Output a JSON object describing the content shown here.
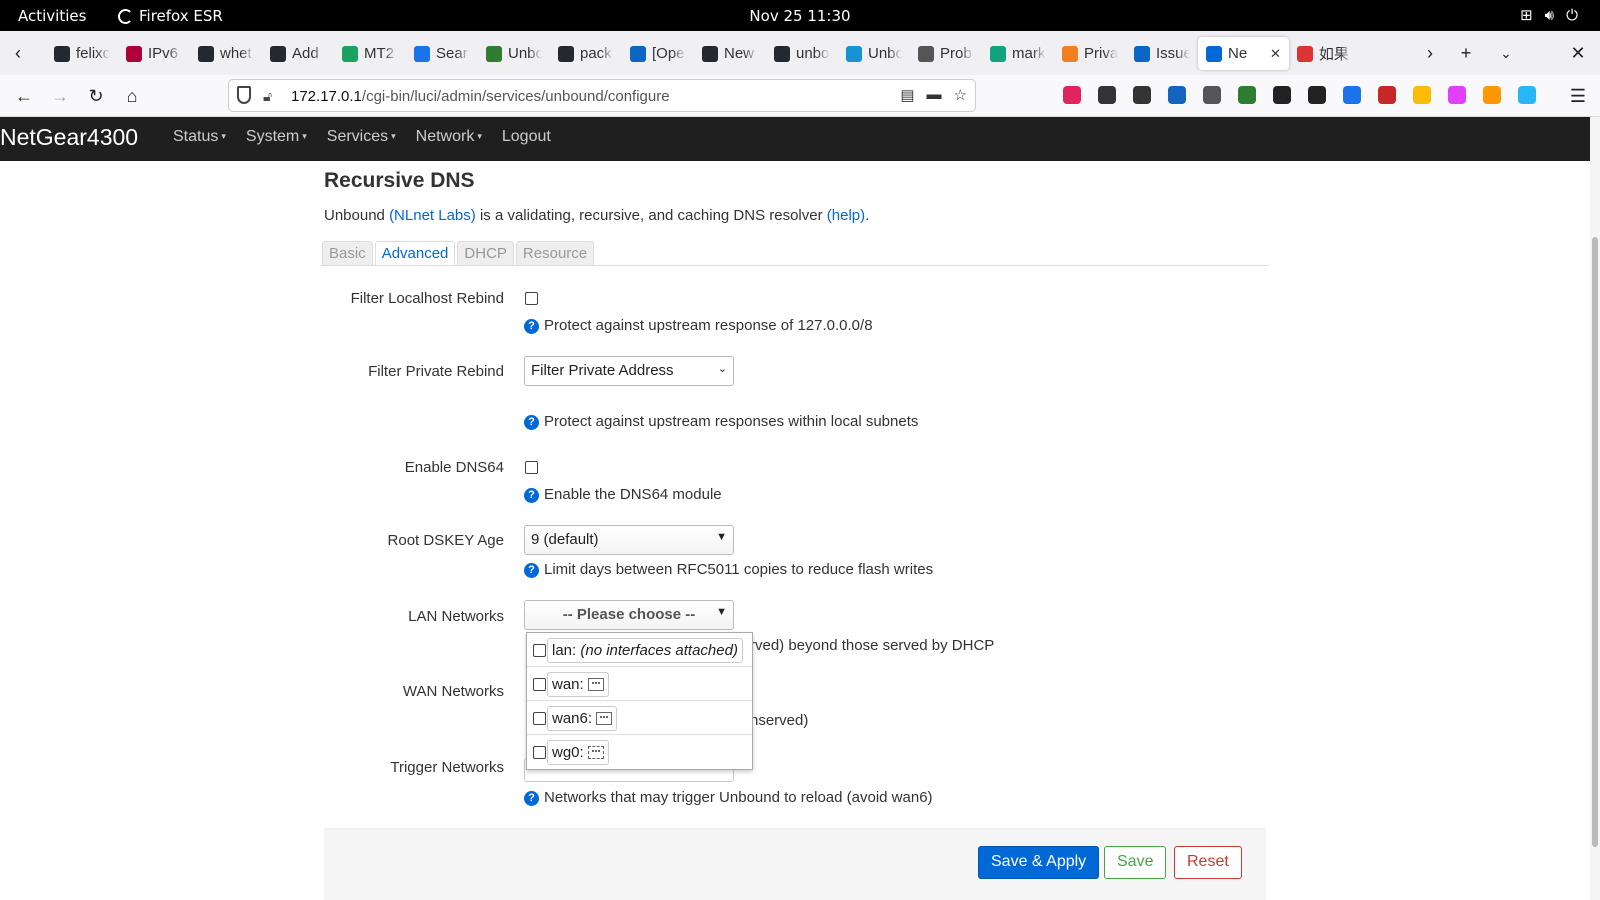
{
  "gnome": {
    "activities": "Activities",
    "app_name": "Firefox ESR",
    "clock": "Nov 25  11:30",
    "tray_icons": [
      "network-icon",
      "volume-icon",
      "power-icon"
    ]
  },
  "tabs": [
    {
      "label": "felixc",
      "icon": "github-icon",
      "color": "#24292f"
    },
    {
      "label": "IPv6",
      "icon": "v6-icon",
      "color": "#b0003a"
    },
    {
      "label": "whet",
      "icon": "github-icon",
      "color": "#24292f"
    },
    {
      "label": "Add",
      "icon": "github-icon",
      "color": "#24292f"
    },
    {
      "label": "MT2",
      "icon": "f-icon",
      "color": "#1aa260"
    },
    {
      "label": "Sear",
      "icon": "search-chart-icon",
      "color": "#1a73e8"
    },
    {
      "label": "Unbo",
      "icon": "freesh-icon",
      "color": "#2e7d32"
    },
    {
      "label": "pack",
      "icon": "github-icon",
      "color": "#24292f"
    },
    {
      "label": "[Ope",
      "icon": "openwrt-icon",
      "color": "#0a66c2"
    },
    {
      "label": "New",
      "icon": "github-icon",
      "color": "#24292f"
    },
    {
      "label": "unbo",
      "icon": "github-icon",
      "color": "#24292f"
    },
    {
      "label": "Unbo",
      "icon": "arch-icon",
      "color": "#1793d1"
    },
    {
      "label": "Prob",
      "icon": "info-icon",
      "color": "#555"
    },
    {
      "label": "mark",
      "icon": "chatgpt-icon",
      "color": "#10a37f"
    },
    {
      "label": "Priva",
      "icon": "cloudflare-icon",
      "color": "#f38020"
    },
    {
      "label": "Issue",
      "icon": "openwrt-icon",
      "color": "#0a66c2"
    },
    {
      "label": "Ne",
      "icon": "radio-icon",
      "color": "#0069d6",
      "active": true
    },
    {
      "label": "如果",
      "icon": "jian-icon",
      "color": "#d33"
    }
  ],
  "browser": {
    "url_host": "172.17.0.1",
    "url_path": "/cgi-bin/luci/admin/services/unbound/configure",
    "ext_colors": [
      "#e0245e",
      "#333",
      "#333",
      "#1565c0",
      "#555",
      "#2e7d32",
      "#222",
      "#222",
      "#1a73e8",
      "#c62828",
      "#fbbc05",
      "#e040fb",
      "#ff9800",
      "#29b6f6"
    ]
  },
  "luci": {
    "brand": "NetGear4300",
    "menu": [
      "Status",
      "System",
      "Services",
      "Network",
      "Logout"
    ]
  },
  "page": {
    "title": "Recursive DNS",
    "desc_prefix": "Unbound ",
    "desc_link1": "(NLnet Labs)",
    "desc_middle": " is a validating, recursive, and caching DNS resolver ",
    "desc_link2": "(help)",
    "desc_suffix": ".",
    "tabs": [
      "Basic",
      "Advanced",
      "DHCP",
      "Resource"
    ]
  },
  "fields": {
    "filter_localhost": {
      "label": "Filter Localhost Rebind",
      "help": "Protect against upstream response of 127.0.0.0/8"
    },
    "filter_private": {
      "label": "Filter Private Rebind",
      "value": "Filter Private Address",
      "help": "Protect against upstream responses within local subnets"
    },
    "dns64": {
      "label": "Enable DNS64",
      "help": "Enable the DNS64 module"
    },
    "dskey": {
      "label": "Root DSKEY Age",
      "value": "9 (default)",
      "help": "Limit days between RFC5011 copies to reduce flash writes"
    },
    "lan": {
      "label": "LAN Networks",
      "value": "-- Please choose --",
      "help_visible": "rved) beyond those served by DHCP"
    },
    "wan": {
      "label": "WAN Networks",
      "help_visible": "nserved)"
    },
    "trigger": {
      "label": "Trigger Networks",
      "help": "Networks that may trigger Unbound to reload (avoid wan6)"
    }
  },
  "dropdown": {
    "items": [
      {
        "name": "lan:",
        "note": "(no interfaces attached)"
      },
      {
        "name": "wan:",
        "note": ""
      },
      {
        "name": "wan6:",
        "note": ""
      },
      {
        "name": "wg0:",
        "note": ""
      }
    ]
  },
  "actions": {
    "save_apply": "Save & Apply",
    "save": "Save",
    "reset": "Reset"
  }
}
